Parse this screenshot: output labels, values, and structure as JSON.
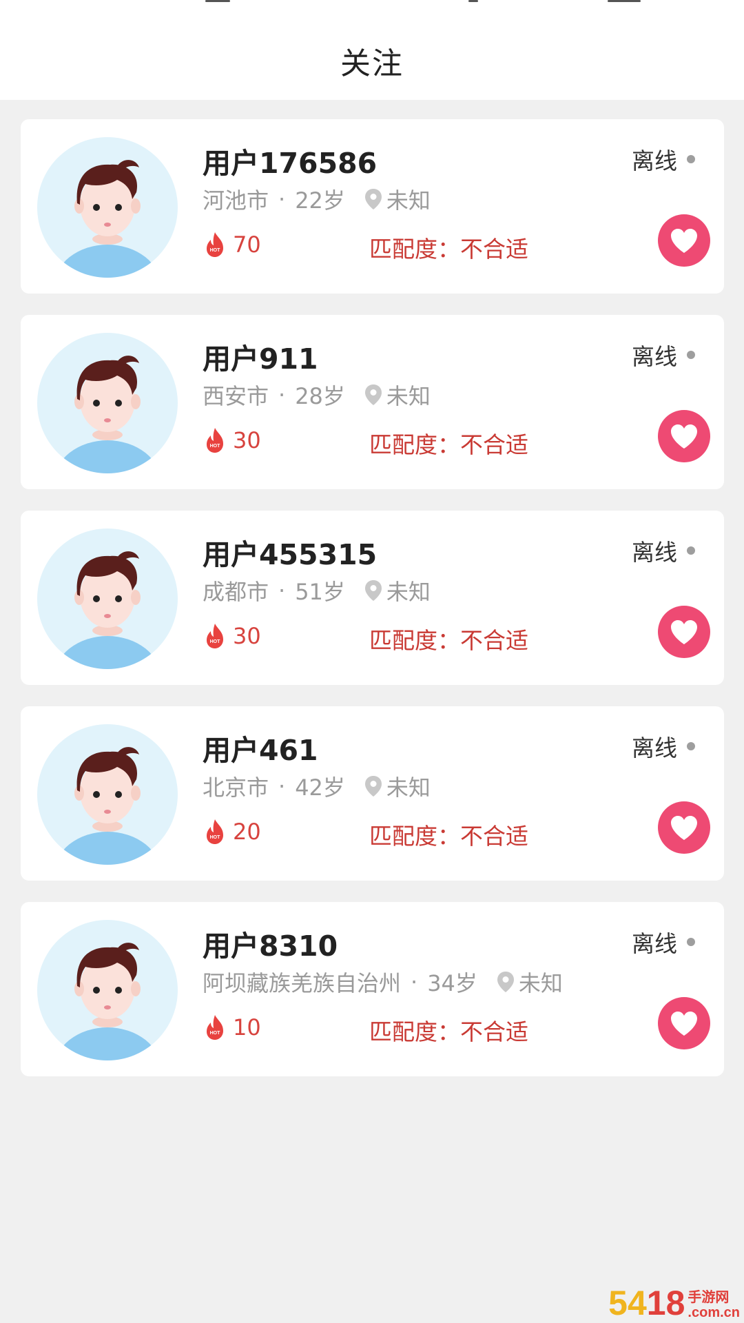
{
  "header": {
    "title": "关注"
  },
  "users": [
    {
      "name": "用户176586",
      "city": "河池市",
      "age": "22岁",
      "location": "未知",
      "hot": "70",
      "match_label": "匹配度：",
      "match_value": "不合适",
      "status": "离线"
    },
    {
      "name": "用户911",
      "city": "西安市",
      "age": "28岁",
      "location": "未知",
      "hot": "30",
      "match_label": "匹配度：",
      "match_value": "不合适",
      "status": "离线"
    },
    {
      "name": "用户455315",
      "city": "成都市",
      "age": "51岁",
      "location": "未知",
      "hot": "30",
      "match_label": "匹配度：",
      "match_value": "不合适",
      "status": "离线"
    },
    {
      "name": "用户461",
      "city": "北京市",
      "age": "42岁",
      "location": "未知",
      "hot": "20",
      "match_label": "匹配度：",
      "match_value": "不合适",
      "status": "离线"
    },
    {
      "name": "用户8310",
      "city": "阿坝藏族羌族自治州",
      "age": "34岁",
      "location": "未知",
      "hot": "10",
      "match_label": "匹配度：",
      "match_value": "不合适",
      "status": "离线"
    }
  ],
  "separator": "·",
  "icons": {
    "avatar": "avatar-icon",
    "location": "location-pin-icon",
    "hot": "hot-flame-icon",
    "like": "heart-icon"
  },
  "colors": {
    "accent": "#ee4a73",
    "match": "#c93a34",
    "hot": "#d7433e",
    "status_dot": "#9e9e9e",
    "background": "#f0f0f0"
  },
  "watermark": {
    "big": "54𝟏𝟖",
    "small": "手游网\n.com.cn"
  }
}
